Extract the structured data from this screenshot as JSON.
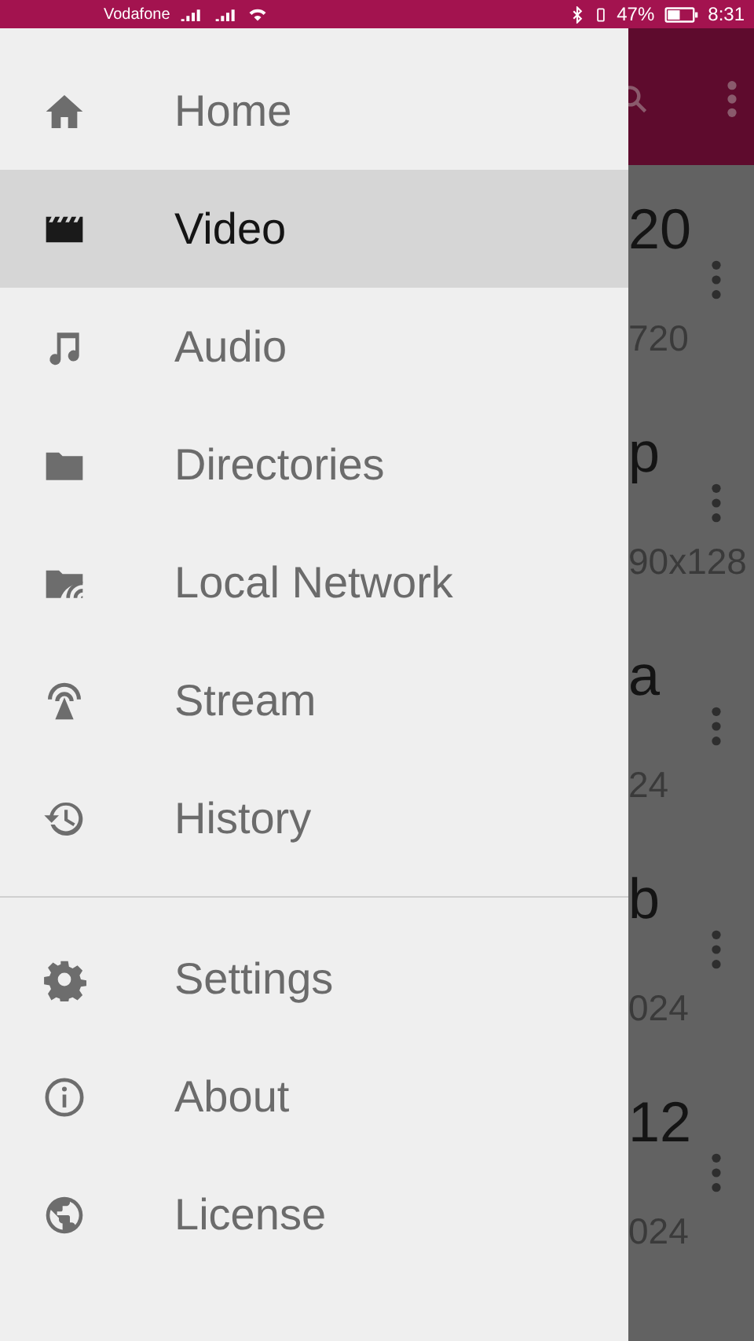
{
  "status_bar": {
    "carrier": "Vodafone",
    "battery": "47%",
    "time": "8:31"
  },
  "background_list": [
    {
      "title": "20",
      "subtitle": "720"
    },
    {
      "title": "p",
      "subtitle": "90x128"
    },
    {
      "title": "a",
      "subtitle": "24"
    },
    {
      "title": "b",
      "subtitle": "024"
    },
    {
      "title": "12",
      "subtitle": "024"
    }
  ],
  "drawer": {
    "main_items": [
      {
        "label": "Home",
        "selected": false
      },
      {
        "label": "Video",
        "selected": true
      },
      {
        "label": "Audio",
        "selected": false
      },
      {
        "label": "Directories",
        "selected": false
      },
      {
        "label": "Local Network",
        "selected": false
      },
      {
        "label": "Stream",
        "selected": false
      },
      {
        "label": "History",
        "selected": false
      }
    ],
    "other_items": [
      {
        "label": "Settings",
        "selected": false
      },
      {
        "label": "About",
        "selected": false
      },
      {
        "label": "License",
        "selected": false
      }
    ]
  }
}
